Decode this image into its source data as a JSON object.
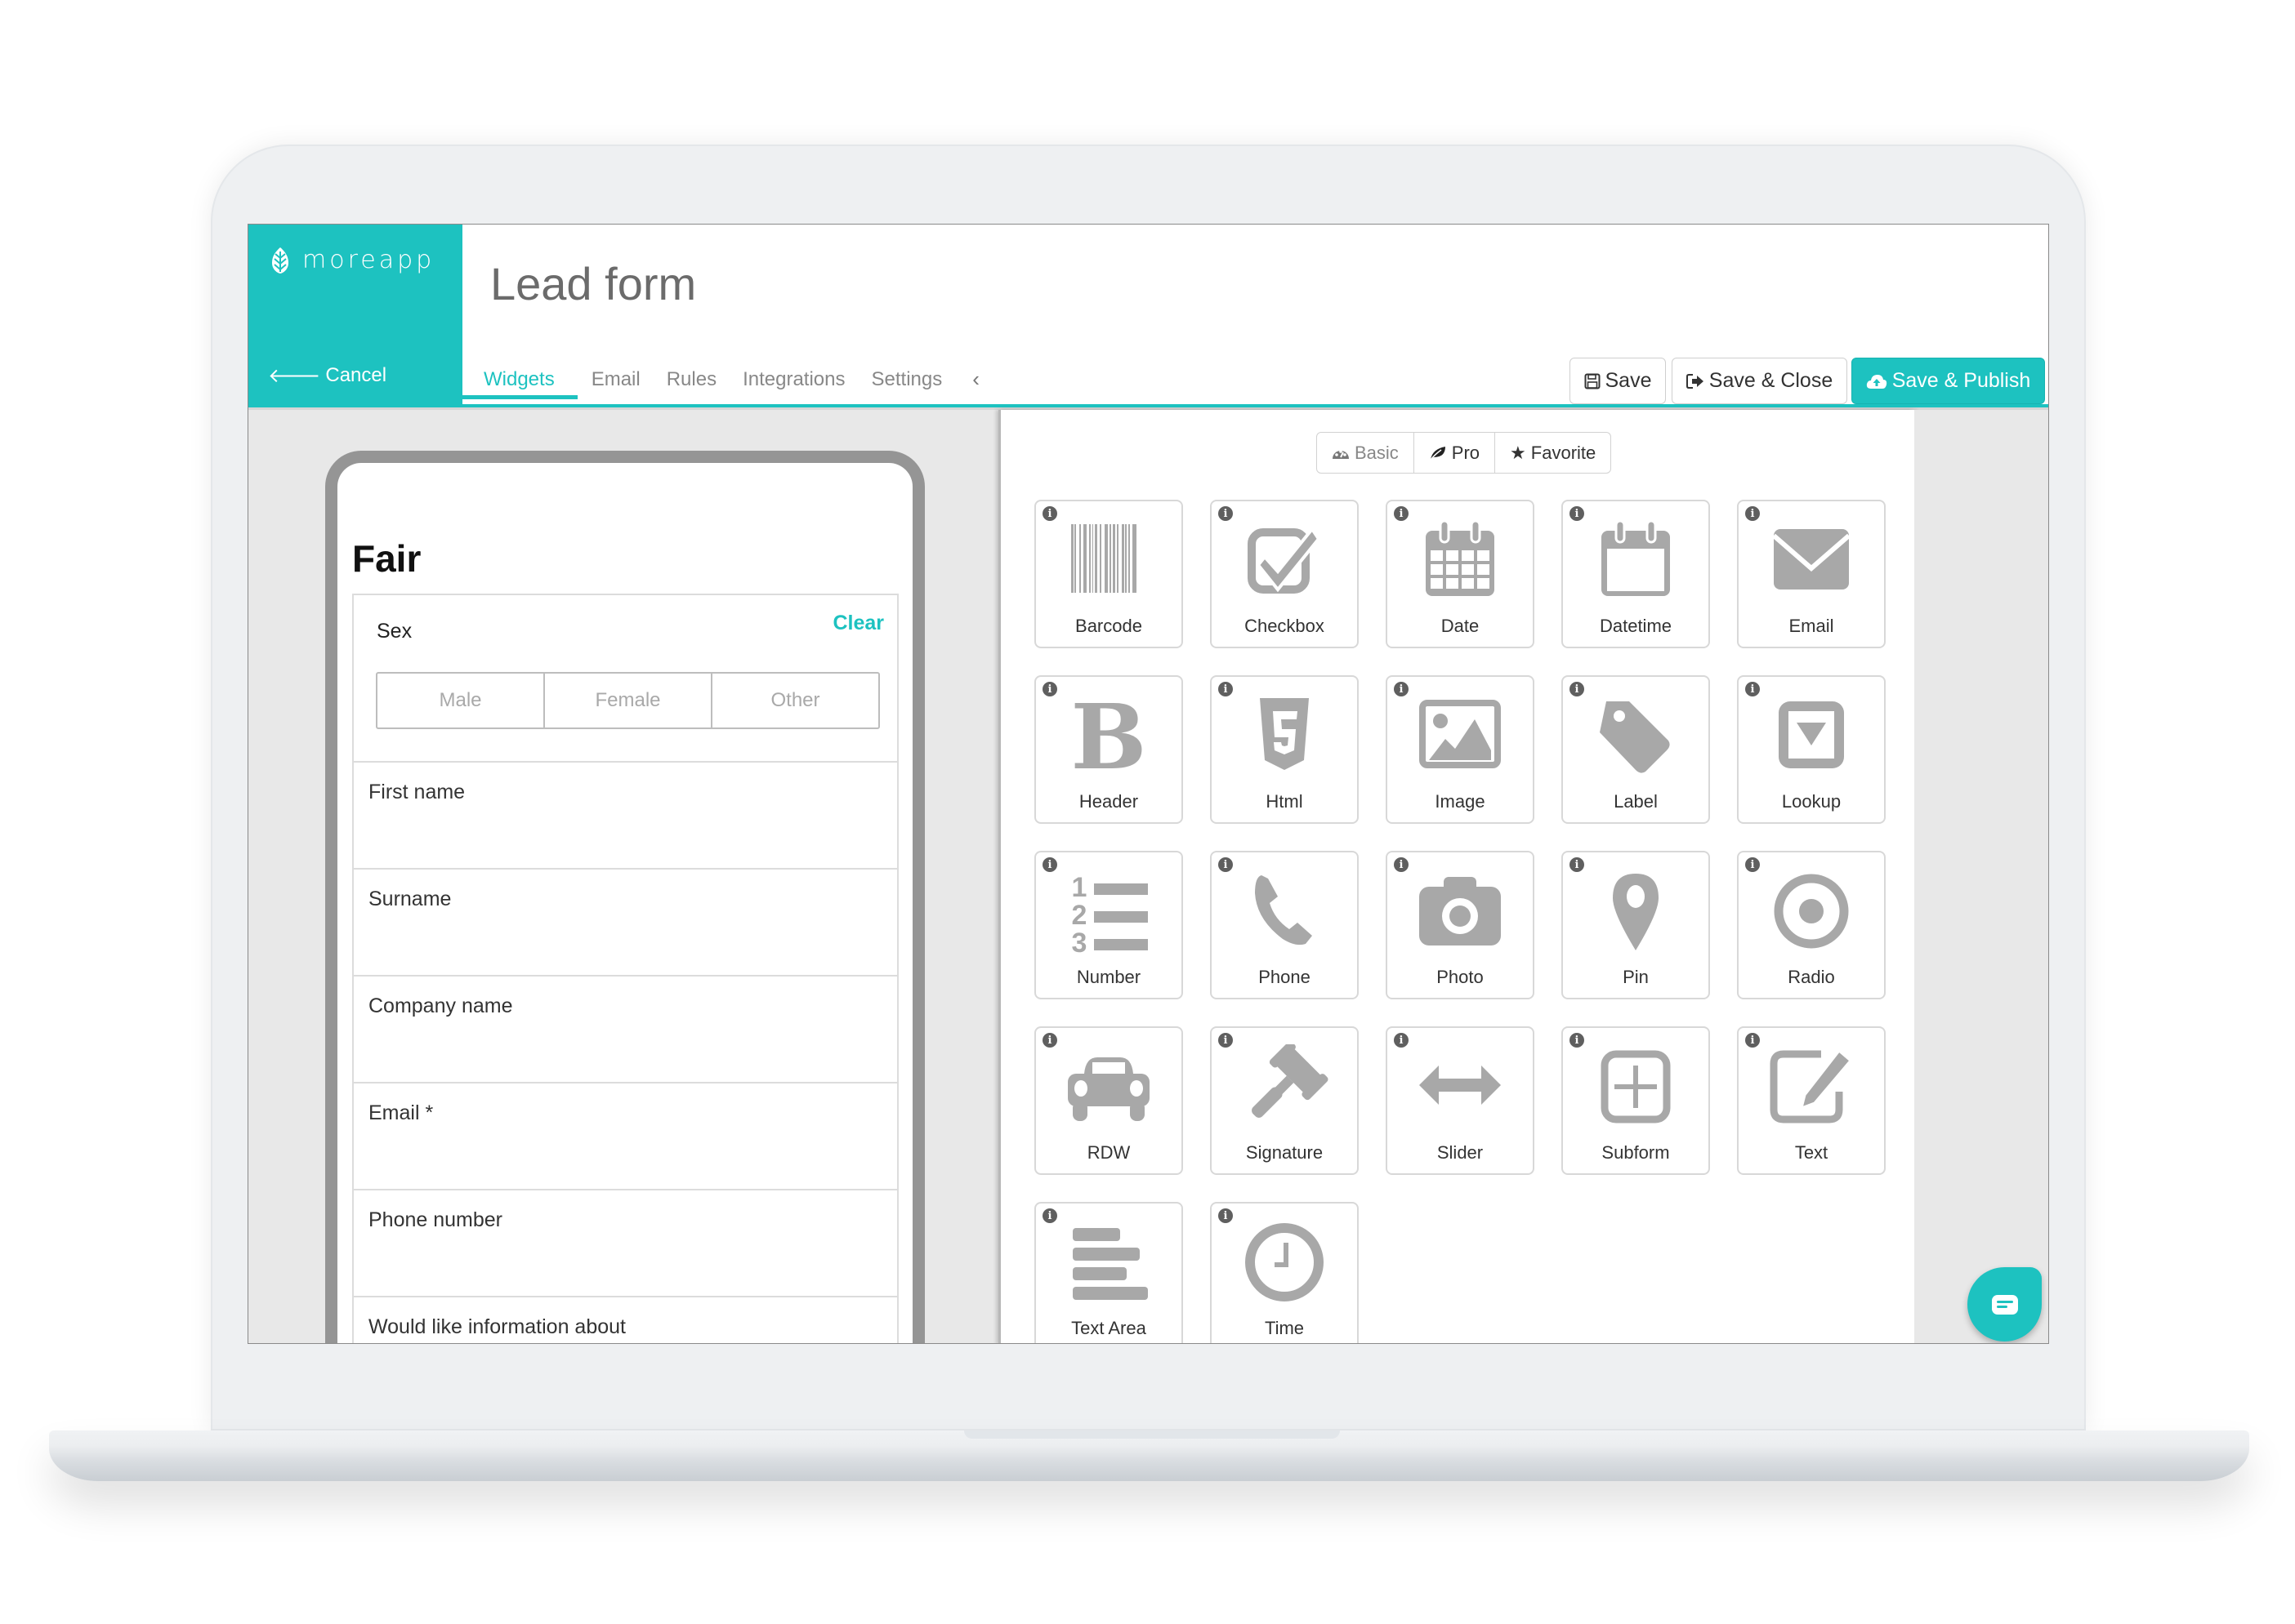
{
  "app": {
    "brand": "moreapp",
    "cancel_label": "Cancel",
    "page_title": "Lead form",
    "accent_color": "#1dc2c0"
  },
  "tabs": [
    {
      "label": "Widgets",
      "active": true
    },
    {
      "label": "Email",
      "active": false
    },
    {
      "label": "Rules",
      "active": false
    },
    {
      "label": "Integrations",
      "active": false
    },
    {
      "label": "Settings",
      "active": false
    }
  ],
  "toolbar": {
    "save_label": "Save",
    "save_close_label": "Save & Close",
    "save_publish_label": "Save & Publish"
  },
  "preview": {
    "form_title": "Fair",
    "sex": {
      "label": "Sex",
      "clear_label": "Clear",
      "options": [
        "Male",
        "Female",
        "Other"
      ]
    },
    "fields": [
      {
        "label": "First name"
      },
      {
        "label": "Surname"
      },
      {
        "label": "Company name"
      },
      {
        "label": "Email *"
      },
      {
        "label": "Phone number"
      },
      {
        "label": "Would like information about"
      }
    ]
  },
  "widget_filter": {
    "options": [
      {
        "label": "Basic",
        "icon": "dashboard-icon"
      },
      {
        "label": "Pro",
        "icon": "leaf-icon"
      },
      {
        "label": "Favorite",
        "icon": "star-icon"
      }
    ]
  },
  "widgets": [
    {
      "label": "Barcode",
      "icon": "barcode-icon"
    },
    {
      "label": "Checkbox",
      "icon": "checkbox-icon"
    },
    {
      "label": "Date",
      "icon": "calendar-icon"
    },
    {
      "label": "Datetime",
      "icon": "calendar-blank-icon"
    },
    {
      "label": "Email",
      "icon": "envelope-icon"
    },
    {
      "label": "Header",
      "icon": "bold-icon"
    },
    {
      "label": "Html",
      "icon": "html5-icon"
    },
    {
      "label": "Image",
      "icon": "image-icon"
    },
    {
      "label": "Label",
      "icon": "tag-icon"
    },
    {
      "label": "Lookup",
      "icon": "dropdown-icon"
    },
    {
      "label": "Number",
      "icon": "numbered-list-icon"
    },
    {
      "label": "Phone",
      "icon": "phone-icon"
    },
    {
      "label": "Photo",
      "icon": "camera-icon"
    },
    {
      "label": "Pin",
      "icon": "map-pin-icon"
    },
    {
      "label": "Radio",
      "icon": "radio-icon"
    },
    {
      "label": "RDW",
      "icon": "car-icon"
    },
    {
      "label": "Signature",
      "icon": "gavel-icon"
    },
    {
      "label": "Slider",
      "icon": "arrows-horizontal-icon"
    },
    {
      "label": "Subform",
      "icon": "plus-square-icon"
    },
    {
      "label": "Text",
      "icon": "edit-icon"
    },
    {
      "label": "Text Area",
      "icon": "align-left-icon"
    },
    {
      "label": "Time",
      "icon": "clock-icon"
    }
  ]
}
